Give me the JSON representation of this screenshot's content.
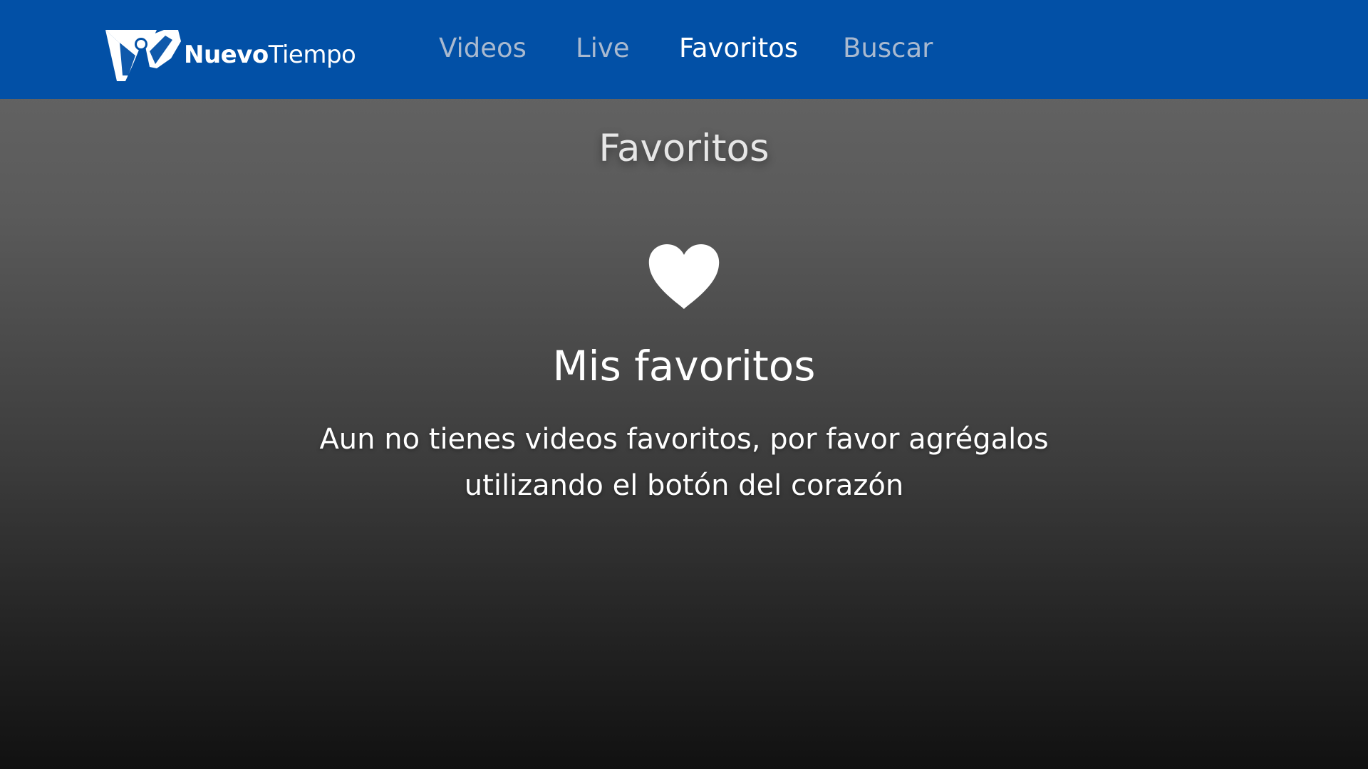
{
  "brand": {
    "name_bold": "Nuevo",
    "name_regular": "Tiempo",
    "logo_icon": "nuevotiempo-logo-icon",
    "bar_color": "#0250a6"
  },
  "nav": {
    "items": [
      {
        "label": "Videos",
        "active": false
      },
      {
        "label": "Live",
        "active": false
      },
      {
        "label": "Favoritos",
        "active": true
      },
      {
        "label": "Buscar",
        "active": false
      }
    ]
  },
  "page": {
    "title": "Favoritos"
  },
  "empty_state": {
    "icon": "heart-icon",
    "title": "Mis favoritos",
    "message": "Aun no tienes videos favoritos, por favor agrégalos utilizando el botón del corazón"
  }
}
